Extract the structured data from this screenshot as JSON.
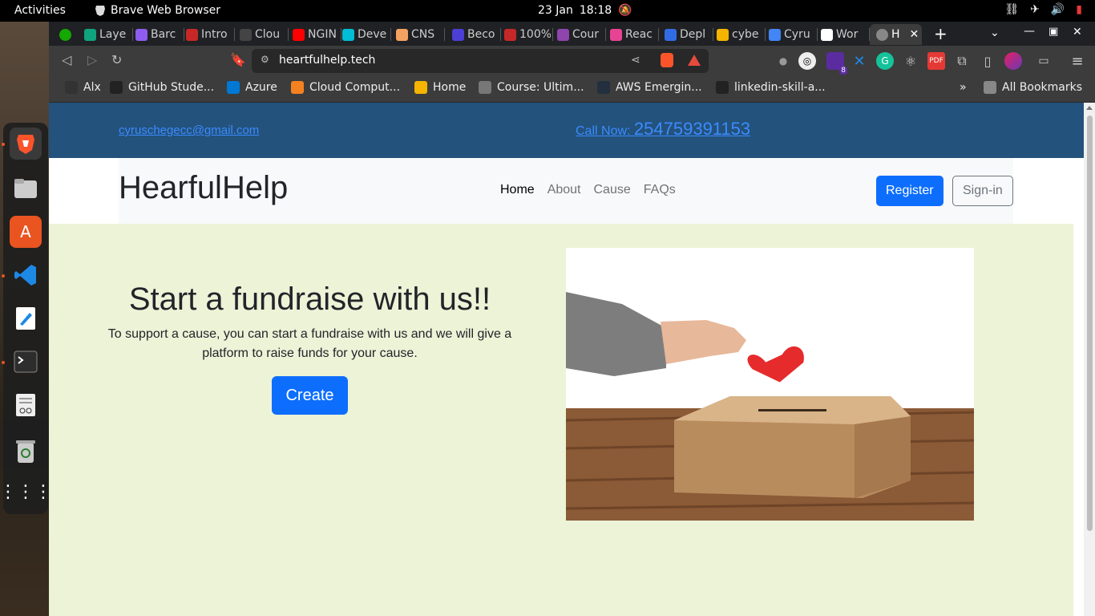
{
  "topbar": {
    "activities": "Activities",
    "app_name": "Brave Web Browser",
    "date": "23 Jan",
    "time": "18:18"
  },
  "tabs": [
    {
      "label": "Laye",
      "color": "#10a37f"
    },
    {
      "label": "Barc",
      "color": "#8e5cf0"
    },
    {
      "label": "Intro",
      "color": "#c62828"
    },
    {
      "label": "Clou",
      "color": "#444444"
    },
    {
      "label": "NGIN",
      "color": "#ff0000"
    },
    {
      "label": "Deve",
      "color": "#00bcd4"
    },
    {
      "label": "CNS",
      "color": "#f4a261"
    },
    {
      "label": "Beco",
      "color": "#4b3fd6"
    },
    {
      "label": "100%",
      "color": "#c62828"
    },
    {
      "label": "Cour",
      "color": "#8e44ad"
    },
    {
      "label": "Reac",
      "color": "#e84393"
    },
    {
      "label": "Depl",
      "color": "#326ce5"
    },
    {
      "label": "cybe",
      "color": "#f4b400"
    },
    {
      "label": "Cyru",
      "color": "#4285f4"
    },
    {
      "label": "Wor",
      "color": "#ffffff"
    },
    {
      "label": "H",
      "color": "#888888"
    }
  ],
  "address_bar": {
    "url": "heartfulhelp.tech"
  },
  "extensions": {
    "badge_count": "8"
  },
  "bookmarks": [
    {
      "label": "Alx",
      "color": "#333333"
    },
    {
      "label": "GitHub Stude...",
      "color": "#222222"
    },
    {
      "label": "Azure",
      "color": "#0078d4"
    },
    {
      "label": "Cloud Comput...",
      "color": "#f48120"
    },
    {
      "label": "Home",
      "color": "#f4b400"
    },
    {
      "label": "Course: Ultim...",
      "color": "#777777"
    },
    {
      "label": "AWS Emergin...",
      "color": "#232f3e"
    },
    {
      "label": "linkedin-skill-a...",
      "color": "#222222"
    }
  ],
  "all_bookmarks": "All Bookmarks",
  "site": {
    "email": "cyruschegecc@gmail.com",
    "call_label": "Call Now:",
    "phone": "254759391153",
    "brand": "HearfulHelp",
    "nav": [
      "Home",
      "About",
      "Cause",
      "FAQs"
    ],
    "register": "Register",
    "signin": "Sign-in",
    "hero_title": "Start a fundraise with us!!",
    "hero_desc": "To support a cause, you can start a fundraise with us and we will give a platform to raise funds for your cause.",
    "create": "Create"
  },
  "colors": {
    "primary": "#0d6efd",
    "contact_bar": "#23527c",
    "hero_bg": "#ecf3d7"
  }
}
